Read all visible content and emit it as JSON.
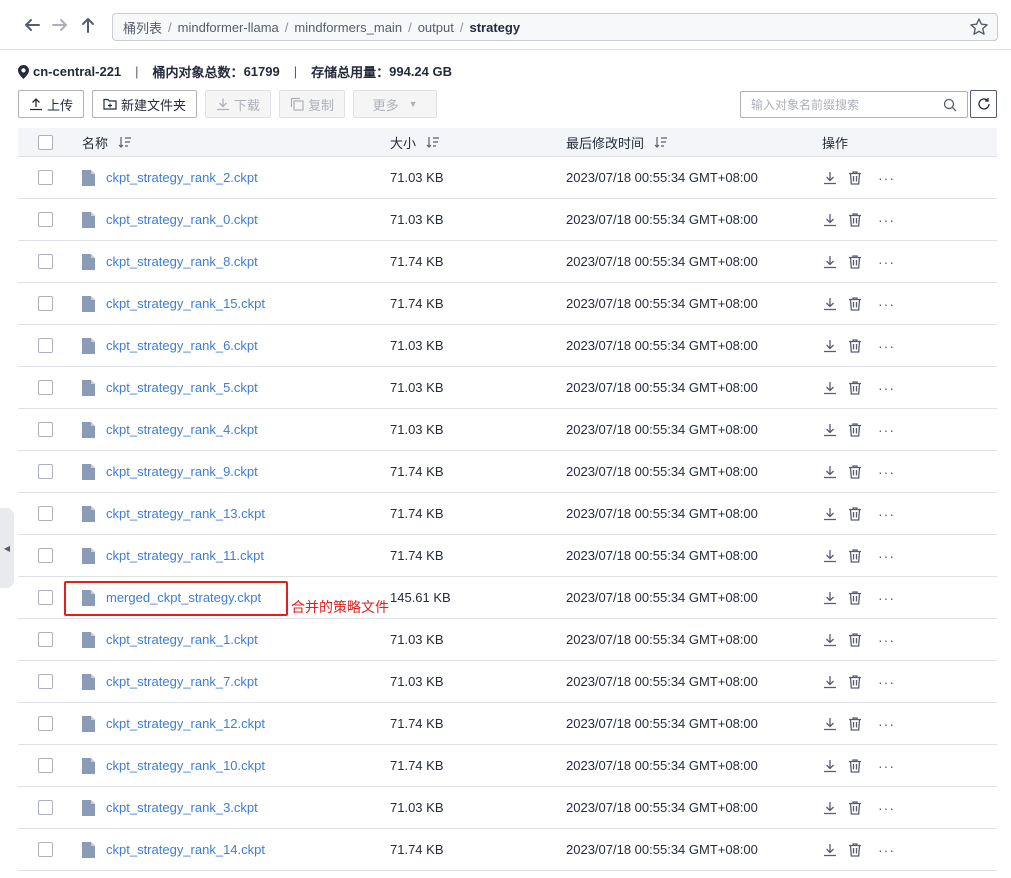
{
  "nav": {
    "breadcrumb": [
      "桶列表",
      "mindformer-llama",
      "mindformers_main",
      "output"
    ],
    "breadcrumb_last": "strategy",
    "separator": "/"
  },
  "bucket_info": {
    "region": "cn-central-221",
    "object_count_label": "桶内对象总数：",
    "object_count": "61799",
    "storage_label": "存储总用量：",
    "storage": "994.24 GB",
    "divider": "|"
  },
  "toolbar": {
    "upload": "上传",
    "new_folder": "新建文件夹",
    "download": "下载",
    "copy": "复制",
    "more": "更多",
    "search_placeholder": "输入对象名前缀搜索"
  },
  "table": {
    "headers": {
      "name": "名称",
      "size": "大小",
      "modified": "最后修改时间",
      "ops": "操作"
    },
    "more_glyph": "···",
    "rows": [
      {
        "name": "ckpt_strategy_rank_2.ckpt",
        "size": "71.03 KB",
        "modified": "2023/07/18 00:55:34 GMT+08:00"
      },
      {
        "name": "ckpt_strategy_rank_0.ckpt",
        "size": "71.03 KB",
        "modified": "2023/07/18 00:55:34 GMT+08:00"
      },
      {
        "name": "ckpt_strategy_rank_8.ckpt",
        "size": "71.74 KB",
        "modified": "2023/07/18 00:55:34 GMT+08:00"
      },
      {
        "name": "ckpt_strategy_rank_15.ckpt",
        "size": "71.74 KB",
        "modified": "2023/07/18 00:55:34 GMT+08:00"
      },
      {
        "name": "ckpt_strategy_rank_6.ckpt",
        "size": "71.03 KB",
        "modified": "2023/07/18 00:55:34 GMT+08:00"
      },
      {
        "name": "ckpt_strategy_rank_5.ckpt",
        "size": "71.03 KB",
        "modified": "2023/07/18 00:55:34 GMT+08:00"
      },
      {
        "name": "ckpt_strategy_rank_4.ckpt",
        "size": "71.03 KB",
        "modified": "2023/07/18 00:55:34 GMT+08:00"
      },
      {
        "name": "ckpt_strategy_rank_9.ckpt",
        "size": "71.74 KB",
        "modified": "2023/07/18 00:55:34 GMT+08:00"
      },
      {
        "name": "ckpt_strategy_rank_13.ckpt",
        "size": "71.74 KB",
        "modified": "2023/07/18 00:55:34 GMT+08:00"
      },
      {
        "name": "ckpt_strategy_rank_11.ckpt",
        "size": "71.74 KB",
        "modified": "2023/07/18 00:55:34 GMT+08:00"
      },
      {
        "name": "merged_ckpt_strategy.ckpt",
        "size": "145.61 KB",
        "modified": "2023/07/18 00:55:34 GMT+08:00"
      },
      {
        "name": "ckpt_strategy_rank_1.ckpt",
        "size": "71.03 KB",
        "modified": "2023/07/18 00:55:34 GMT+08:00"
      },
      {
        "name": "ckpt_strategy_rank_7.ckpt",
        "size": "71.03 KB",
        "modified": "2023/07/18 00:55:34 GMT+08:00"
      },
      {
        "name": "ckpt_strategy_rank_12.ckpt",
        "size": "71.74 KB",
        "modified": "2023/07/18 00:55:34 GMT+08:00"
      },
      {
        "name": "ckpt_strategy_rank_10.ckpt",
        "size": "71.74 KB",
        "modified": "2023/07/18 00:55:34 GMT+08:00"
      },
      {
        "name": "ckpt_strategy_rank_3.ckpt",
        "size": "71.03 KB",
        "modified": "2023/07/18 00:55:34 GMT+08:00"
      },
      {
        "name": "ckpt_strategy_rank_14.ckpt",
        "size": "71.74 KB",
        "modified": "2023/07/18 00:55:34 GMT+08:00"
      }
    ]
  },
  "annotation": {
    "text": "合并的策略文件",
    "color": "#e0211f"
  },
  "colors": {
    "link": "#3b7dd8",
    "header_bg": "#f3f5f8",
    "border": "#dfe1e6"
  }
}
